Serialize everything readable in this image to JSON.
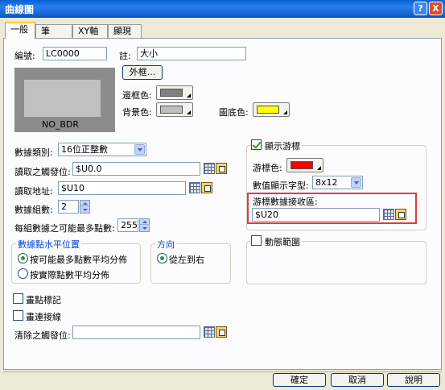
{
  "window": {
    "title": "曲線圖",
    "help": "?",
    "close": "X"
  },
  "tabs": [
    {
      "label": "一般",
      "active": true
    },
    {
      "label": "筆",
      "active": false
    },
    {
      "label": "XY軸",
      "active": false
    },
    {
      "label": "顯現",
      "active": false
    }
  ],
  "general": {
    "id_label": "編號:",
    "id_value": "LC0000",
    "note_label": "註:",
    "note_value": "大小",
    "frame_button": "外框...",
    "border_color_label": "邊框色:",
    "bg_color_label": "背景色:",
    "base_color_label": "圖底色:",
    "preview_text": "NO_BDR",
    "colors": {
      "border": "#808080",
      "bg": "#c0c0c0",
      "base": "#ffff00",
      "cursor": "#ff0000"
    },
    "data_type_label": "數據類別:",
    "data_type_value": "16位正整數",
    "read_control_label": "讀取之觸發位:",
    "read_control_value": "$U0.0",
    "read_addr_label": "讀取地址:",
    "read_addr_value": "$U10",
    "groups_label": "數據組數:",
    "groups_value": "2",
    "max_points_label": "每組數據之可能最多點數:",
    "max_points_value": "255",
    "hpos_group_title": "數據點水平位置",
    "hpos_option1": "按可能最多點數平均分佈",
    "hpos_option2": "按實際點數平均分佈",
    "direction_title": "方向",
    "direction_option": "從左到右",
    "mark_points_label": "畫點標記",
    "connect_line_label": "畫連接線",
    "clear_control_label": "清除之觸發位:",
    "clear_control_value": ""
  },
  "cursor": {
    "show_label": "顯示游標",
    "show_checked": true,
    "color_label": "游標色:",
    "font_label": "數值顯示字型:",
    "font_value": "8x12",
    "recv_label": "游標數據接收區:",
    "recv_value": "$U20"
  },
  "dynamic": {
    "label": "動態範圍",
    "checked": false
  },
  "footer": {
    "ok": "確定",
    "cancel": "取消",
    "help": "說明"
  }
}
